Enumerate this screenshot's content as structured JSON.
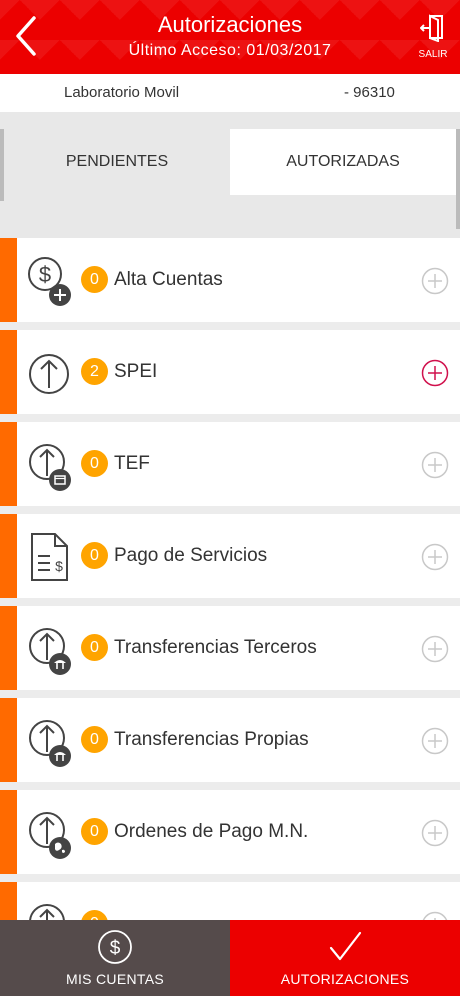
{
  "header": {
    "title": "Autorizaciones",
    "subtitle": "Último Acceso: 01/03/2017",
    "back_icon": "chevron-left-icon",
    "logout_label": "SALIR",
    "logout_icon": "exit-door-icon",
    "background": "#ec0000"
  },
  "account": {
    "name": "Laboratorio Movil",
    "number": "- 96310"
  },
  "tabs": {
    "pending": "PENDIENTES",
    "authorized": "AUTORIZADAS"
  },
  "accent_color": "#ff6a00",
  "badge_color": "#ffa400",
  "items": [
    {
      "count": "0",
      "label": "Alta Cuentas",
      "icon": "dollar-add-icon",
      "add_active": false
    },
    {
      "count": "2",
      "label": "SPEI",
      "icon": "arrow-up-icon",
      "add_active": true
    },
    {
      "count": "0",
      "label": "TEF",
      "icon": "arrow-up-calendar-icon",
      "add_active": false
    },
    {
      "count": "0",
      "label": "Pago de Servicios",
      "icon": "invoice-icon",
      "add_active": false
    },
    {
      "count": "0",
      "label": "Transferencias Terceros",
      "icon": "arrow-up-bank-icon",
      "add_active": false
    },
    {
      "count": "0",
      "label": "Transferencias Propias",
      "icon": "arrow-up-bank-icon",
      "add_active": false
    },
    {
      "count": "0",
      "label": "Ordenes de Pago M.N.",
      "icon": "arrow-up-globe-icon",
      "add_active": false
    },
    {
      "count": "0",
      "label": "",
      "icon": "arrow-up-icon",
      "add_active": false
    }
  ],
  "bottom_nav": {
    "accounts_label": "MIS CUENTAS",
    "accounts_icon": "dollar-circle-icon",
    "authorizations_label": "AUTORIZACIONES",
    "authorizations_icon": "checkmark-icon"
  }
}
